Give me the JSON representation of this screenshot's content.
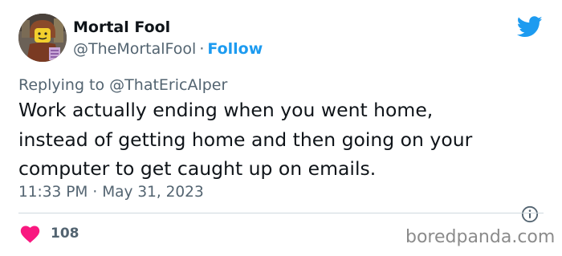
{
  "author": {
    "name": "Mortal Fool",
    "handle": "@TheMortalFool",
    "separator": "·",
    "follow_label": "Follow",
    "avatar_icon": "lego-minifigure-avatar"
  },
  "reply": {
    "prefix": "Replying to",
    "handle": "@ThatEricAlper"
  },
  "tweet": {
    "lines": [
      "Work actually ending when you went home,",
      "instead of getting home and then going on your",
      "computer to get caught up on emails."
    ],
    "time": "11:33 PM",
    "separator": "·",
    "date": "May 31, 2023"
  },
  "engagement": {
    "likes": "108",
    "like_icon": "heart-icon",
    "info_icon": "info-icon"
  },
  "watermark": "boredpanda.com",
  "colors": {
    "twitter_blue": "#1d9bf0",
    "like_red": "#f91880",
    "secondary_text": "#536471",
    "primary_text": "#0f1419",
    "divider": "#cfd9de"
  },
  "brand_icon": "twitter-bird-icon"
}
